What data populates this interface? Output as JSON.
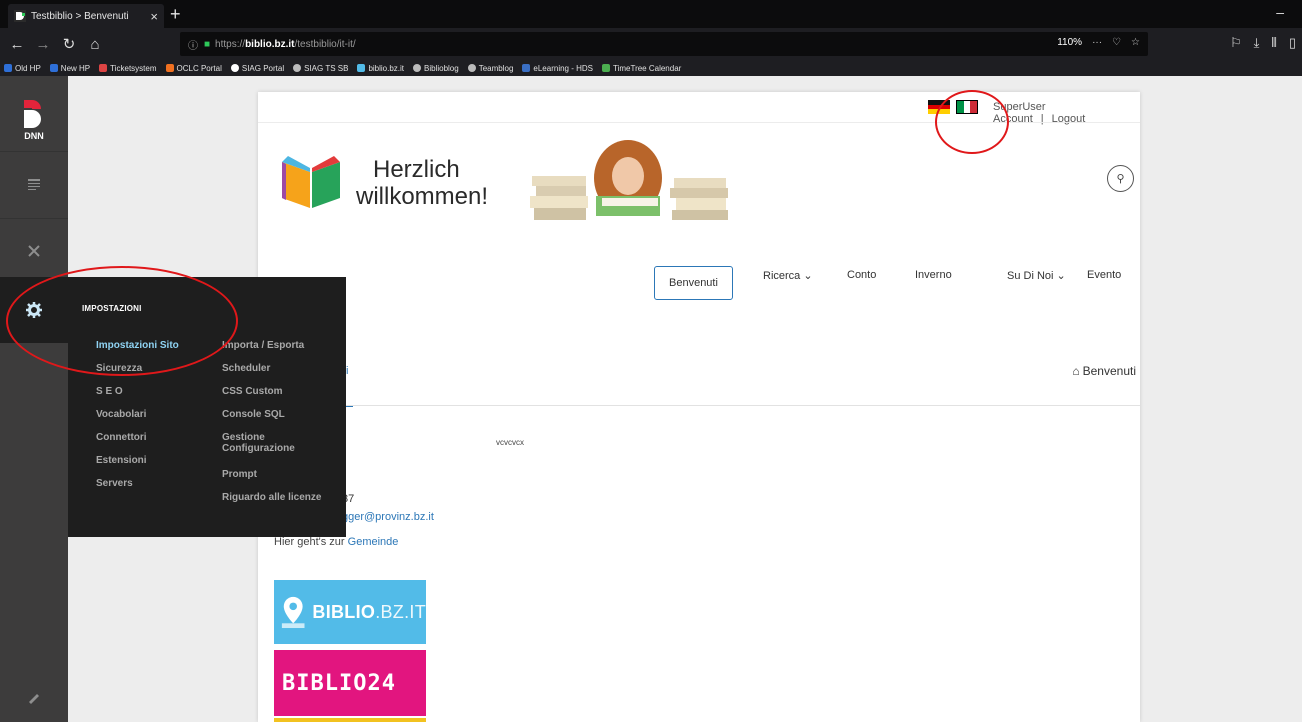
{
  "browser": {
    "tab_title": "Testbiblio > Benvenuti",
    "url_prefix": "https://",
    "url_domain": "biblio.bz.it",
    "url_path": "/testbiblio/it-it/",
    "zoom": "110%",
    "bookmarks": [
      "Old HP",
      "New HP",
      "Ticketsystem",
      "OCLC Portal",
      "SIAG Portal",
      "SIAG TS SB",
      "biblio.bz.it",
      "Biblioblog",
      "Teamblog",
      "eLearning - HDS",
      "TimeTree Calendar"
    ]
  },
  "persona_bar": {
    "logo_text": "DNN"
  },
  "settings_menu": {
    "title": "IMPOSTAZIONI",
    "col1": [
      "Impostazioni Sito",
      "Sicurezza",
      "S E O",
      "Vocabolari",
      "Connettori",
      "Estensioni",
      "Servers"
    ],
    "col2": [
      "Importa / Esporta",
      "Scheduler",
      "CSS Custom",
      "Console SQL",
      "Gestione Configurazione",
      "Prompt",
      "Riguardo alle licenze"
    ]
  },
  "site": {
    "account": "SuperUser Account",
    "separator": "|",
    "logout": "Logout",
    "welcome_line1": "Herzlich",
    "welcome_line2": "willkommen!",
    "menu": [
      "Benvenuti",
      "Ricerca ⌄",
      "Conto",
      "Inverno",
      "Su Di Noi ⌄",
      "Evento"
    ],
    "breadcrumb_left": "ti",
    "breadcrumb_right": "Benvenuti",
    "vc_text": "vcvcvcx",
    "phone_fragment": "37",
    "email_fragment": "gger@provinz.bz.it",
    "gemeinde_prefix": "Hier geht's zur ",
    "gemeinde_link": "Gemeinde",
    "banner1": "BIBLIO",
    "banner1_suffix": ".BZ.IT",
    "banner2": "BIBLIO24"
  },
  "colors": {
    "accent": "#2c77b7",
    "annotation": "#e0181a",
    "persona_bg": "#3d3c3c",
    "flyout_bg": "#1e1e1e"
  }
}
